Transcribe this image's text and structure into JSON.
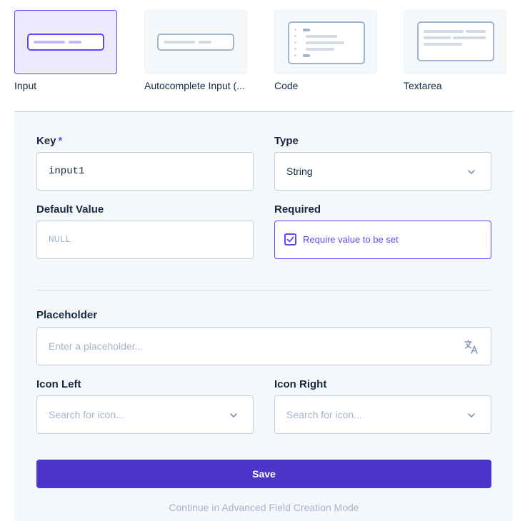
{
  "interface_types": [
    {
      "label": "Input",
      "selected": true
    },
    {
      "label": "Autocomplete Input (...",
      "selected": false
    },
    {
      "label": "Code",
      "selected": false
    },
    {
      "label": "Textarea",
      "selected": false
    }
  ],
  "form": {
    "key": {
      "label": "Key",
      "required_mark": "*",
      "value": "input1"
    },
    "type": {
      "label": "Type",
      "value": "String"
    },
    "default_value": {
      "label": "Default Value",
      "placeholder": "NULL"
    },
    "required": {
      "label": "Required",
      "checkbox_label": "Require value to be set",
      "checked": true
    },
    "placeholder": {
      "label": "Placeholder",
      "placeholder": "Enter a placeholder..."
    },
    "icon_left": {
      "label": "Icon Left",
      "placeholder": "Search for icon..."
    },
    "icon_right": {
      "label": "Icon Right",
      "placeholder": "Search for icon..."
    }
  },
  "actions": {
    "save_label": "Save",
    "advanced_label": "Continue in Advanced Field Creation Mode"
  },
  "icons": {
    "type_dropdown": "chevron-down-icon",
    "placeholder_translate": "translate-icon",
    "icon_dropdowns": "chevron-down-icon",
    "checkbox": "checkbox-checked-icon"
  },
  "colors": {
    "accent": "#6644ff",
    "save_button": "#4b36c9",
    "panel_bg": "#f5f8fb",
    "muted_text": "#a2b5cd"
  }
}
